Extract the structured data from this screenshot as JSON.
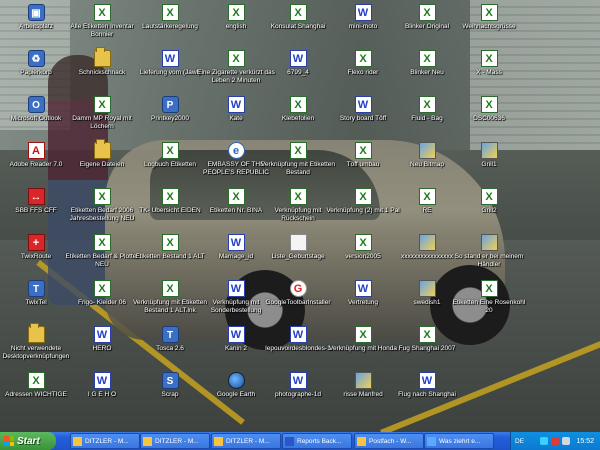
{
  "desktop": {
    "icons": [
      {
        "label": "Arbeitsplatz",
        "icon": "computer-icon"
      },
      {
        "label": "Papierkorb",
        "icon": "recycle-bin-icon"
      },
      {
        "label": "Microsoft Outlook",
        "icon": "outlook-icon"
      },
      {
        "label": "Adobe Reader 7.0",
        "icon": "pdf-icon"
      },
      {
        "label": "SBB FFS CFF",
        "icon": "sbb-icon"
      },
      {
        "label": "TwixRoute",
        "icon": "swiss-flag-icon"
      },
      {
        "label": "TwixTel",
        "icon": "twixtel-icon"
      },
      {
        "label": "Nicht verwendete Desktopverknüpfungen",
        "icon": "folder-icon"
      },
      {
        "label": "Adressen WICHTIGE",
        "icon": "excel-icon"
      },
      {
        "label": "Alle Etiketten Inventar Bonnier",
        "icon": "excel-icon"
      },
      {
        "label": "Schnickschnack",
        "icon": "folder-icon"
      },
      {
        "label": "Damm MP Royal mit Löchern",
        "icon": "excel-icon"
      },
      {
        "label": "Eigene Dateien",
        "icon": "folder-icon"
      },
      {
        "label": "Etiketten Bedarf 2006 Jahresbestellung NEU",
        "icon": "excel-icon"
      },
      {
        "label": "Etiketten Bedarf & Plotter NEU",
        "icon": "excel-icon"
      },
      {
        "label": "Frigo- Kleider 06",
        "icon": "excel-icon"
      },
      {
        "label": "HERO",
        "icon": "word-icon"
      },
      {
        "label": "I G E H O",
        "icon": "word-icon"
      },
      {
        "label": "Lautstärkeregelung",
        "icon": "excel-icon"
      },
      {
        "label": "Lieferung vom (Jawl)",
        "icon": "word-icon"
      },
      {
        "label": "Printkey2000",
        "icon": "printkey-icon"
      },
      {
        "label": "Logbuch Etiketten",
        "icon": "excel-icon"
      },
      {
        "label": "TK- Ubersicht EIDEN",
        "icon": "excel-icon"
      },
      {
        "label": "Etiketten Bestand 1 ALT",
        "icon": "excel-icon"
      },
      {
        "label": "Verknüpfung mit Etiketten Bestand 1 ALT.lnk",
        "icon": "excel-icon"
      },
      {
        "label": "Tosca 2.6",
        "icon": "tosca-icon"
      },
      {
        "label": "Scrap",
        "icon": "scrap-icon"
      },
      {
        "label": "english",
        "icon": "excel-icon"
      },
      {
        "label": "Eine Zigarette verkürzt das Leben 2 Minuten",
        "icon": "excel-icon"
      },
      {
        "label": "Kate",
        "icon": "word-icon"
      },
      {
        "label": "EMBASSY OF THE PEOPLE'S REPUBLIC",
        "icon": "ie-icon"
      },
      {
        "label": "Etiketten Nr. BINA",
        "icon": "excel-icon"
      },
      {
        "label": "Marriage_id",
        "icon": "word-icon"
      },
      {
        "label": "Verknüpfung mit Sonderbestellung",
        "icon": "word-icon"
      },
      {
        "label": "Kanin 2",
        "icon": "word-icon"
      },
      {
        "label": "Google Earth",
        "icon": "google-earth-icon"
      },
      {
        "label": "Konsulat Shanghai",
        "icon": "excel-icon"
      },
      {
        "label": "6799_4",
        "icon": "word-icon"
      },
      {
        "label": "Klebefolien",
        "icon": "excel-icon"
      },
      {
        "label": "Verknüpfung mit Etiketten Bestand",
        "icon": "excel-icon"
      },
      {
        "label": "Verknüpfung mit Rückschein",
        "icon": "excel-icon"
      },
      {
        "label": "Liste_Geburtstage",
        "icon": "file-icon"
      },
      {
        "label": "GoogleToolbarInstaller",
        "icon": "google-icon"
      },
      {
        "label": "lepouvoirdesblondes-1",
        "icon": "word-icon"
      },
      {
        "label": "photographe-1d",
        "icon": "word-icon"
      },
      {
        "label": "mini-moto",
        "icon": "word-icon"
      },
      {
        "label": "Flexo rider",
        "icon": "excel-icon"
      },
      {
        "label": "Story board Töff",
        "icon": "word-icon"
      },
      {
        "label": "Töff umbau",
        "icon": "excel-icon"
      },
      {
        "label": "Verknüpfung (2) mit 1 Pal",
        "icon": "excel-icon"
      },
      {
        "label": "version2005",
        "icon": "excel-icon"
      },
      {
        "label": "Vertretung",
        "icon": "word-icon"
      },
      {
        "label": "Verknüpfung mit Honda",
        "icon": "excel-icon"
      },
      {
        "label": "risse Manfred",
        "icon": "image-icon"
      },
      {
        "label": "Blinker Original",
        "icon": "excel-icon"
      },
      {
        "label": "Blinker Neu",
        "icon": "excel-icon"
      },
      {
        "label": "Fluid - Bag",
        "icon": "excel-icon"
      },
      {
        "label": "Neu Bitmap",
        "icon": "image-icon"
      },
      {
        "label": "RE",
        "icon": "excel-icon"
      },
      {
        "label": "xxxxxxxxxxxxxxxx",
        "icon": "image-icon"
      },
      {
        "label": "swedish1",
        "icon": "image-icon"
      },
      {
        "label": "Fug Shanghai 2007",
        "icon": "excel-icon"
      },
      {
        "label": "Flug nach Shanghai",
        "icon": "word-icon"
      },
      {
        "label": "Weihnachtsgrüsse",
        "icon": "excel-icon"
      },
      {
        "label": "X - Mass",
        "icon": "excel-icon"
      },
      {
        "label": "DSC00636",
        "icon": "excel-icon"
      },
      {
        "label": "Grill1",
        "icon": "image-icon"
      },
      {
        "label": "Grill2",
        "icon": "excel-icon"
      },
      {
        "label": "So stand er bei meinem Händler",
        "icon": "image-icon"
      },
      {
        "label": "Etiketten Eine Rosenkohl 20",
        "icon": "excel-icon"
      }
    ]
  },
  "taskbar": {
    "start_label": "Start",
    "tasks": [
      {
        "label": "DITZLER - M...",
        "icon": "outlook-task-icon"
      },
      {
        "label": "DITZLER - M...",
        "icon": "outlook-task-icon"
      },
      {
        "label": "DITZLER - M...",
        "icon": "outlook-task-icon"
      },
      {
        "label": "Reports Back...",
        "icon": "word-task-icon"
      },
      {
        "label": "Postfach - W...",
        "icon": "outlook-task-icon"
      },
      {
        "label": "Was ziehrt e...",
        "icon": "ie-task-icon"
      }
    ],
    "tray": {
      "language": "DE",
      "clock": "15:52"
    }
  }
}
